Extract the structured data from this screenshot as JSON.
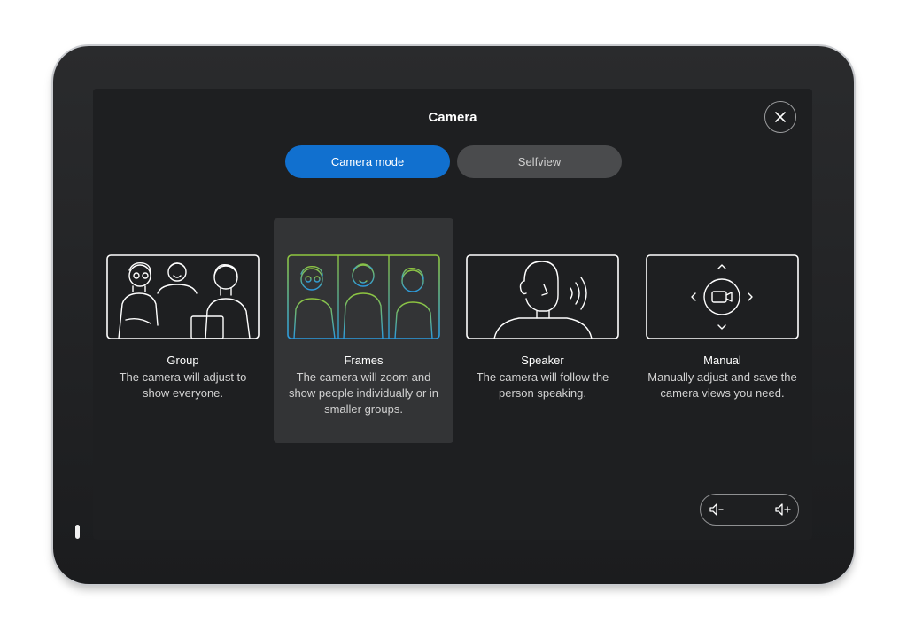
{
  "window": {
    "title": "Camera"
  },
  "tabs": [
    {
      "label": "Camera mode",
      "active": true
    },
    {
      "label": "Selfview",
      "active": false
    }
  ],
  "modes": [
    {
      "name": "Group",
      "description": "The camera will adjust to show everyone.",
      "icon": "group-illustration",
      "selected": false
    },
    {
      "name": "Frames",
      "description": "The camera will zoom and show people individually or in smaller groups.",
      "icon": "frames-illustration",
      "selected": true
    },
    {
      "name": "Speaker",
      "description": "The camera will follow the person speaking.",
      "icon": "speaker-illustration",
      "selected": false
    },
    {
      "name": "Manual",
      "description": "Manually adjust and save the camera views you need.",
      "icon": "manual-illustration",
      "selected": false
    }
  ],
  "volume": {
    "down_icon": "volume-down-icon",
    "up_icon": "volume-up-icon"
  },
  "colors": {
    "accent": "#1170cf",
    "screen_bg": "#1e1f21",
    "selected_bg": "#333436",
    "frames_gradient_start": "#8fc63f",
    "frames_gradient_end": "#2b9be0"
  }
}
